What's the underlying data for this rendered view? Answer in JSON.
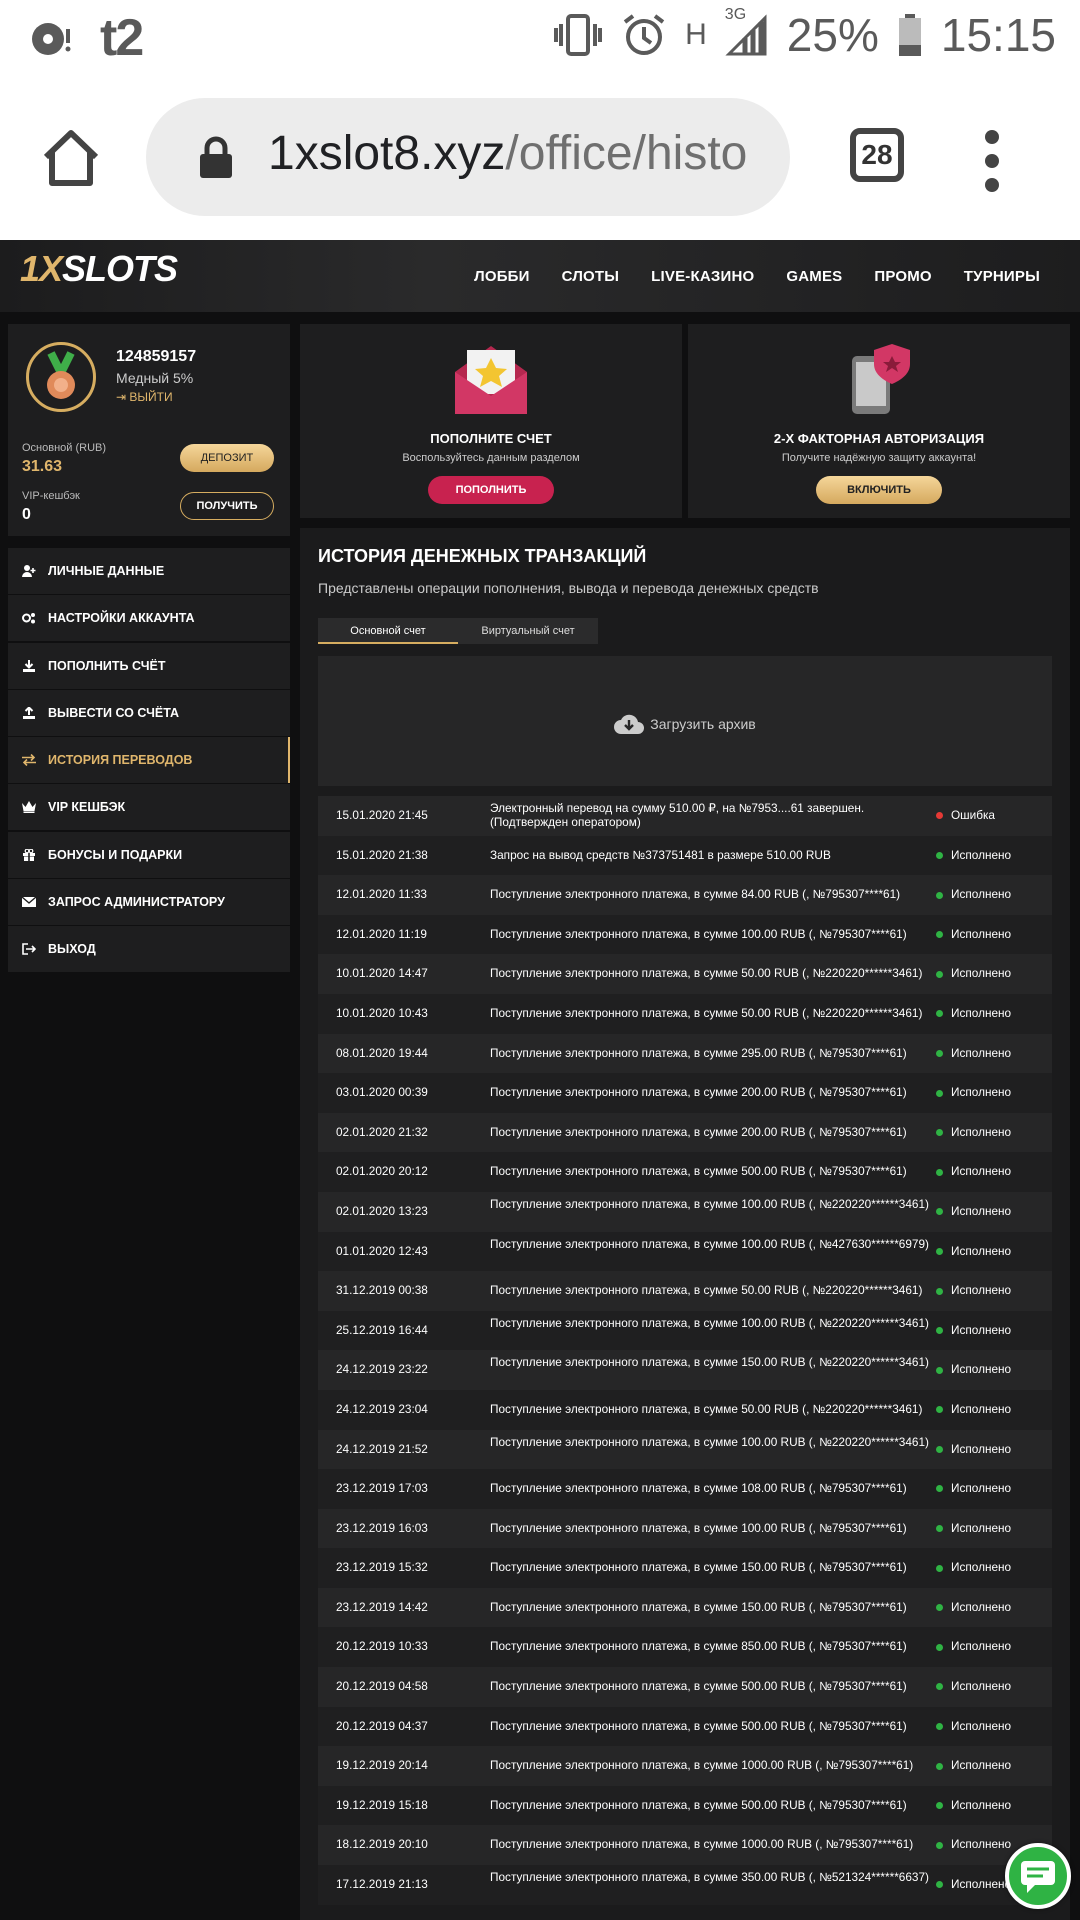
{
  "statusbar": {
    "carrier": "t2",
    "network": "H",
    "network_sub": "3G",
    "battery": "25%",
    "time": "15:15"
  },
  "browser": {
    "domain": "1xslot8.xyz",
    "path": "/office/histo",
    "tab_count": "28"
  },
  "site": {
    "logo_num": "1X",
    "logo_text": "SLOTS",
    "nav": [
      "ЛОББИ",
      "СЛОТЫ",
      "LIVE-КАЗИНО",
      "GAMES",
      "ПРОМО",
      "ТУРНИРЫ"
    ]
  },
  "profile": {
    "user_id": "124859157",
    "rank": "Медный 5%",
    "logout": "ВЫЙТИ",
    "balance_label": "Основной (RUB)",
    "balance": "31.63",
    "vip_label": "VIP-кешбэк",
    "vip_value": "0",
    "deposit_btn": "ДЕПОЗИТ",
    "get_btn": "ПОЛУЧИТЬ"
  },
  "menu": [
    "ЛИЧНЫЕ ДАННЫЕ",
    "НАСТРОЙКИ АККАУНТА",
    "ПОПОЛНИТЬ СЧЁТ",
    "ВЫВЕСТИ СО СЧЁТА",
    "ИСТОРИЯ ПЕРЕВОДОВ",
    "VIP КЕШБЭК",
    "БОНУСЫ И ПОДАРКИ",
    "ЗАПРОС АДМИНИСТРАТОРУ",
    "ВЫХОД"
  ],
  "cards": {
    "topup": {
      "title": "ПОПОЛНИТЕ СЧЕТ",
      "sub": "Воспользуйтесь данным разделом",
      "btn": "ПОПОЛНИТЬ"
    },
    "twofa": {
      "title": "2-Х ФАКТОРНАЯ АВТОРИЗАЦИЯ",
      "sub": "Получите надёжную защиту аккаунта!",
      "btn": "ВКЛЮЧИТЬ"
    }
  },
  "history": {
    "title": "ИСТОРИЯ ДЕНЕЖНЫХ ТРАНЗАКЦИЙ",
    "subtitle": "Представлены операции пополнения, вывода и перевода денежных средств",
    "tabs": [
      "Основной счет",
      "Виртуальный счет"
    ],
    "archive": "Загрузить архив",
    "status_colors": {
      "error": "#e53935",
      "ok": "#2fb344"
    },
    "rows": [
      {
        "date": "15.01.2020 21:45",
        "text": "Электронный перевод на сумму 510.00 ₽, на №7953....61 завершен. (Подтвержден оператором)",
        "status": "Ошибка",
        "type": "error"
      },
      {
        "date": "15.01.2020 21:38",
        "text": "Запрос на вывод средств №373751481 в размере 510.00 RUB",
        "status": "Исполнено",
        "type": "ok"
      },
      {
        "date": "12.01.2020 11:33",
        "text": "Поступление электронного платежа, в сумме 84.00 RUB (, №795307****61)",
        "status": "Исполнено",
        "type": "ok"
      },
      {
        "date": "12.01.2020 11:19",
        "text": "Поступление электронного платежа, в сумме 100.00 RUB (, №795307****61)",
        "status": "Исполнено",
        "type": "ok"
      },
      {
        "date": "10.01.2020 14:47",
        "text": "Поступление электронного платежа, в сумме 50.00 RUB (, №220220******3461)",
        "status": "Исполнено",
        "type": "ok"
      },
      {
        "date": "10.01.2020 10:43",
        "text": "Поступление электронного платежа, в сумме 50.00 RUB (, №220220******3461)",
        "status": "Исполнено",
        "type": "ok"
      },
      {
        "date": "08.01.2020 19:44",
        "text": "Поступление электронного платежа, в сумме 295.00 RUB (, №795307****61)",
        "status": "Исполнено",
        "type": "ok"
      },
      {
        "date": "03.01.2020 00:39",
        "text": "Поступление электронного платежа, в сумме 200.00 RUB (, №795307****61)",
        "status": "Исполнено",
        "type": "ok"
      },
      {
        "date": "02.01.2020 21:32",
        "text": "Поступление электронного платежа, в сумме 200.00 RUB (, №795307****61)",
        "status": "Исполнено",
        "type": "ok"
      },
      {
        "date": "02.01.2020 20:12",
        "text": "Поступление электронного платежа, в сумме 500.00 RUB (, №795307****61)",
        "status": "Исполнено",
        "type": "ok"
      },
      {
        "date": "02.01.2020 13:23",
        "text": "Поступление электронного платежа, в сумме 100.00 RUB (, №220220******3461)",
        "status": "Исполнено",
        "type": "ok"
      },
      {
        "date": "01.01.2020 12:43",
        "text": "Поступление электронного платежа, в сумме 100.00 RUB (, №427630******6979)",
        "status": "Исполнено",
        "type": "ok"
      },
      {
        "date": "31.12.2019 00:38",
        "text": "Поступление электронного платежа, в сумме 50.00 RUB (, №220220******3461)",
        "status": "Исполнено",
        "type": "ok"
      },
      {
        "date": "25.12.2019 16:44",
        "text": "Поступление электронного платежа, в сумме 100.00 RUB (, №220220******3461)",
        "status": "Исполнено",
        "type": "ok"
      },
      {
        "date": "24.12.2019 23:22",
        "text": "Поступление электронного платежа, в сумме 150.00 RUB (, №220220******3461)",
        "status": "Исполнено",
        "type": "ok"
      },
      {
        "date": "24.12.2019 23:04",
        "text": "Поступление электронного платежа, в сумме 50.00 RUB (, №220220******3461)",
        "status": "Исполнено",
        "type": "ok"
      },
      {
        "date": "24.12.2019 21:52",
        "text": "Поступление электронного платежа, в сумме 100.00 RUB (, №220220******3461)",
        "status": "Исполнено",
        "type": "ok"
      },
      {
        "date": "23.12.2019 17:03",
        "text": "Поступление электронного платежа, в сумме 108.00 RUB (, №795307****61)",
        "status": "Исполнено",
        "type": "ok"
      },
      {
        "date": "23.12.2019 16:03",
        "text": "Поступление электронного платежа, в сумме 100.00 RUB (, №795307****61)",
        "status": "Исполнено",
        "type": "ok"
      },
      {
        "date": "23.12.2019 15:32",
        "text": "Поступление электронного платежа, в сумме 150.00 RUB (, №795307****61)",
        "status": "Исполнено",
        "type": "ok"
      },
      {
        "date": "23.12.2019 14:42",
        "text": "Поступление электронного платежа, в сумме 150.00 RUB (, №795307****61)",
        "status": "Исполнено",
        "type": "ok"
      },
      {
        "date": "20.12.2019 10:33",
        "text": "Поступление электронного платежа, в сумме 850.00 RUB (, №795307****61)",
        "status": "Исполнено",
        "type": "ok"
      },
      {
        "date": "20.12.2019 04:58",
        "text": "Поступление электронного платежа, в сумме 500.00 RUB (, №795307****61)",
        "status": "Исполнено",
        "type": "ok"
      },
      {
        "date": "20.12.2019 04:37",
        "text": "Поступление электронного платежа, в сумме 500.00 RUB (, №795307****61)",
        "status": "Исполнено",
        "type": "ok"
      },
      {
        "date": "19.12.2019 20:14",
        "text": "Поступление электронного платежа, в сумме 1000.00 RUB (, №795307****61)",
        "status": "Исполнено",
        "type": "ok"
      },
      {
        "date": "19.12.2019 15:18",
        "text": "Поступление электронного платежа, в сумме 500.00 RUB (, №795307****61)",
        "status": "Исполнено",
        "type": "ok"
      },
      {
        "date": "18.12.2019 20:10",
        "text": "Поступление электронного платежа, в сумме 1000.00 RUB (, №795307****61)",
        "status": "Исполнено",
        "type": "ok"
      },
      {
        "date": "17.12.2019 21:13",
        "text": "Поступление электронного платежа, в сумме 350.00 RUB (, №521324******6637)",
        "status": "Исполнено",
        "type": "ok"
      }
    ]
  }
}
